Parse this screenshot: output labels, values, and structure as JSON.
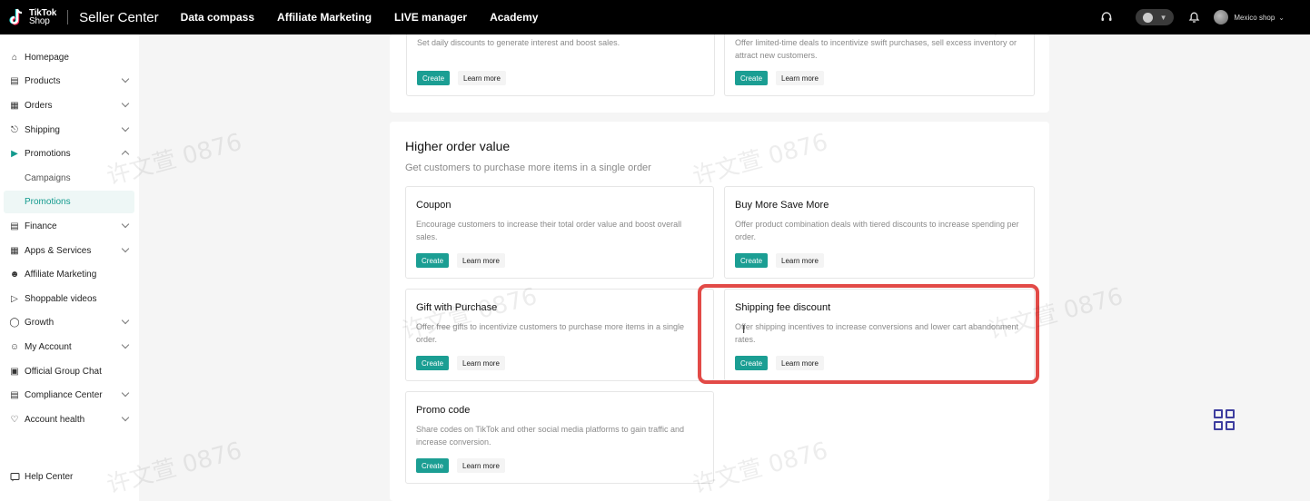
{
  "header": {
    "logo_text_1": "TikTok",
    "logo_text_2": "Shop",
    "brand": "Seller Center",
    "nav": [
      "Data compass",
      "Affiliate Marketing",
      "LIVE manager",
      "Academy"
    ],
    "shop_name": "Mexico shop"
  },
  "sidebar": {
    "items": [
      {
        "label": "Homepage",
        "icon": "home-icon",
        "chevron": false
      },
      {
        "label": "Products",
        "icon": "product-icon",
        "chevron": true
      },
      {
        "label": "Orders",
        "icon": "clipboard-icon",
        "chevron": true
      },
      {
        "label": "Shipping",
        "icon": "truck-icon",
        "chevron": true
      },
      {
        "label": "Promotions",
        "icon": "megaphone-icon",
        "chevron": "up"
      },
      {
        "label": "Finance",
        "icon": "wallet-icon",
        "chevron": true
      },
      {
        "label": "Apps & Services",
        "icon": "apps-icon",
        "chevron": true
      },
      {
        "label": "Affiliate Marketing",
        "icon": "people-icon",
        "chevron": false
      },
      {
        "label": "Shoppable videos",
        "icon": "video-icon",
        "chevron": false
      },
      {
        "label": "Growth",
        "icon": "growth-icon",
        "chevron": true
      },
      {
        "label": "My Account",
        "icon": "user-icon",
        "chevron": true
      },
      {
        "label": "Official Group Chat",
        "icon": "group-chat-icon",
        "chevron": false
      },
      {
        "label": "Compliance Center",
        "icon": "compliance-icon",
        "chevron": true
      },
      {
        "label": "Account health",
        "icon": "health-icon",
        "chevron": true
      }
    ],
    "sub_items": [
      "Campaigns",
      "Promotions"
    ],
    "help": "Help Center"
  },
  "top_cards": [
    {
      "desc": "Set daily discounts to generate interest and boost sales.",
      "create": "Create",
      "learn": "Learn more"
    },
    {
      "desc": "Offer limited-time deals to incentivize swift purchases, sell excess inventory or attract new customers.",
      "create": "Create",
      "learn": "Learn more"
    }
  ],
  "section": {
    "title": "Higher order value",
    "subtitle": "Get customers to purchase more items in a single order",
    "cards": [
      {
        "title": "Coupon",
        "desc": "Encourage customers to increase their total order value and boost overall sales.",
        "create": "Create",
        "learn": "Learn more"
      },
      {
        "title": "Buy More Save More",
        "desc": "Offer product combination deals with tiered discounts to increase spending per order.",
        "create": "Create",
        "learn": "Learn more"
      },
      {
        "title": "Gift with Purchase",
        "desc": "Offer free gifts to incentivize customers to purchase more items in a single order.",
        "create": "Create",
        "learn": "Learn more"
      },
      {
        "title": "Shipping fee discount",
        "desc": "Offer shipping incentives to increase conversions and lower cart abandonment rates.",
        "create": "Create",
        "learn": "Learn more"
      },
      {
        "title": "Promo code",
        "desc": "Share codes on TikTok and other social media platforms to gain traffic and increase conversion.",
        "create": "Create",
        "learn": "Learn more"
      }
    ]
  },
  "watermark": "许文萱 0876",
  "colors": {
    "accent": "#1b9e93",
    "highlight": "#e24a47",
    "topbar": "#000000"
  }
}
